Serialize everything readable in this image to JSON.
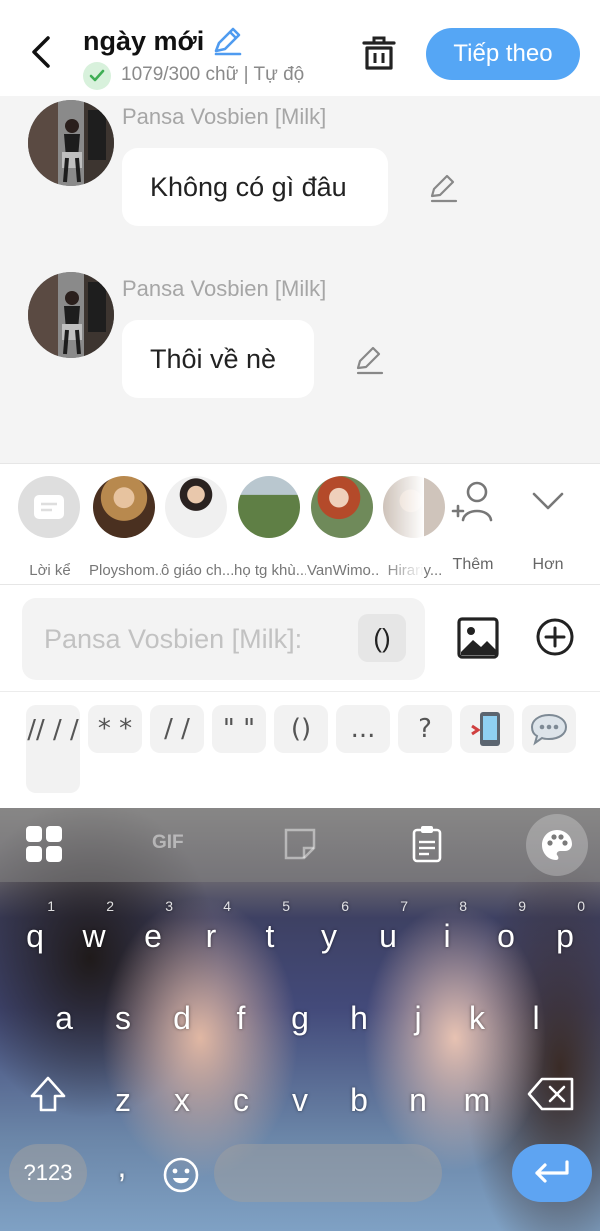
{
  "header": {
    "title": "ngày mới",
    "subtitle": "1079/300 chữ | Tự độ",
    "next_label": "Tiếp theo"
  },
  "messages": [
    {
      "sender": "Pansa Vosbien [Milk]",
      "text": "Không có gì đâu"
    },
    {
      "sender": "Pansa Vosbien [Milk]",
      "text": "Thôi về nè"
    }
  ],
  "characters": [
    {
      "label": "Lời kể"
    },
    {
      "label": "Ployshom..."
    },
    {
      "label": "ô giáo ch..."
    },
    {
      "label": "họ tg khù..."
    },
    {
      "label": "VanWimo..."
    },
    {
      "label": "Hirariy..."
    }
  ],
  "tools": {
    "add_label": "Thêm",
    "more_label": "Hơn"
  },
  "input": {
    "placeholder": "Pansa Vosbien [Milk]:",
    "paren": "()"
  },
  "quick_inserts": [
    "// / /",
    "* *",
    "/ /",
    "\" \"",
    "()",
    "...",
    "?"
  ],
  "keyboard": {
    "gif_label": "GIF",
    "row1": [
      {
        "k": "q",
        "h": "1"
      },
      {
        "k": "w",
        "h": "2"
      },
      {
        "k": "e",
        "h": "3"
      },
      {
        "k": "r",
        "h": "4"
      },
      {
        "k": "t",
        "h": "5"
      },
      {
        "k": "y",
        "h": "6"
      },
      {
        "k": "u",
        "h": "7"
      },
      {
        "k": "i",
        "h": "8"
      },
      {
        "k": "o",
        "h": "9"
      },
      {
        "k": "p",
        "h": "0"
      }
    ],
    "row2": [
      "a",
      "s",
      "d",
      "f",
      "g",
      "h",
      "j",
      "k",
      "l"
    ],
    "row3": [
      "z",
      "x",
      "c",
      "v",
      "b",
      "n",
      "m"
    ],
    "symbols_label": "?123",
    "comma": ","
  },
  "colors": {
    "accent": "#55a6f5",
    "chat_bg": "#f4f4f4",
    "check": "#3fae55"
  }
}
